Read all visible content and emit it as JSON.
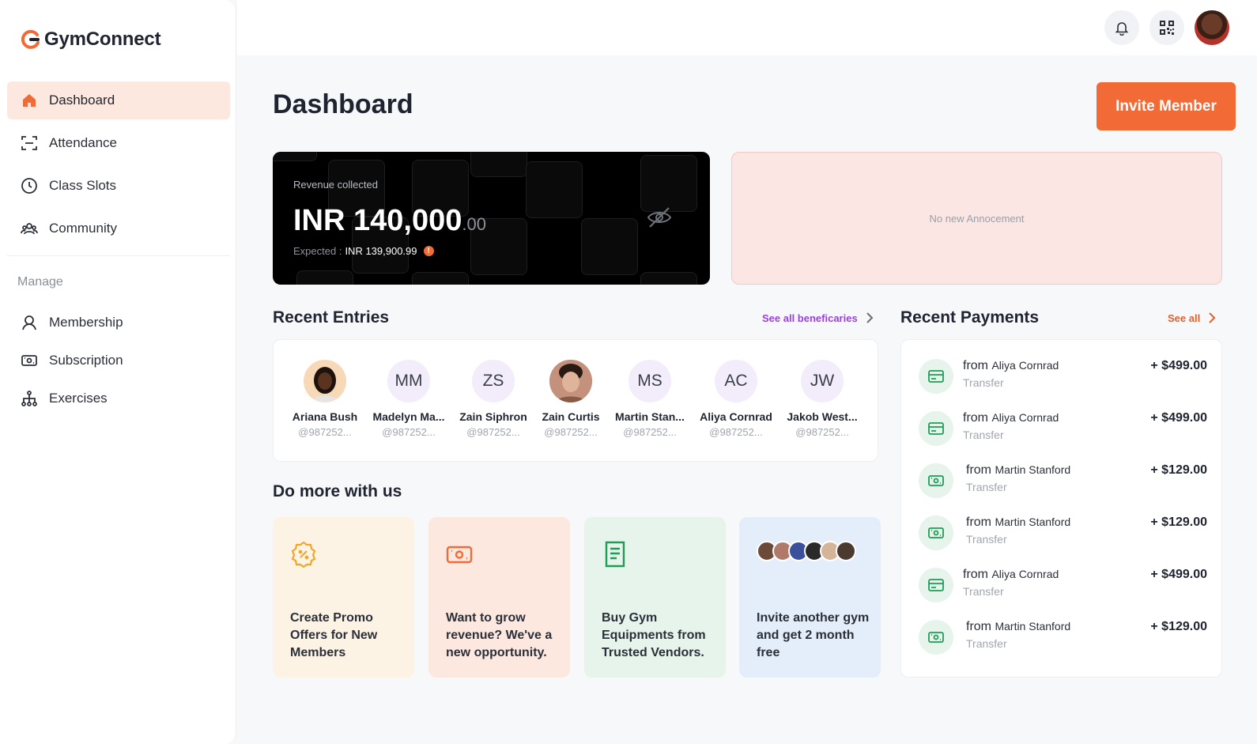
{
  "app": {
    "name": "GymConnect"
  },
  "sidebar": {
    "items": [
      {
        "label": "Dashboard",
        "icon": "home-icon",
        "active": true
      },
      {
        "label": "Attendance",
        "icon": "scan-icon"
      },
      {
        "label": "Class Slots",
        "icon": "clock-icon"
      },
      {
        "label": "Community",
        "icon": "community-icon"
      }
    ],
    "manage_label": "Manage",
    "manage_items": [
      {
        "label": "Membership",
        "icon": "membership-icon"
      },
      {
        "label": "Subscription",
        "icon": "subscription-icon"
      },
      {
        "label": "Exercises",
        "icon": "exercises-icon"
      }
    ]
  },
  "header": {
    "title": "Dashboard",
    "invite_label": "Invite Member"
  },
  "revenue": {
    "label": "Revenue collected",
    "amount": "INR 140,000",
    "cents": ".00",
    "expected_label": "Expected :",
    "expected_value": "INR 139,900.99"
  },
  "announcement": {
    "text": "No new Annocement"
  },
  "recent_entries": {
    "title": "Recent Entries",
    "link": "See all beneficaries",
    "items": [
      {
        "initials": "",
        "name": "Ariana Bush",
        "handle": "@987252..."
      },
      {
        "initials": "MM",
        "name": "Madelyn Ma...",
        "handle": "@987252..."
      },
      {
        "initials": "ZS",
        "name": "Zain Siphron",
        "handle": "@987252..."
      },
      {
        "initials": "",
        "name": "Zain Curtis",
        "handle": "@987252..."
      },
      {
        "initials": "MS",
        "name": "Martin Stan...",
        "handle": "@987252..."
      },
      {
        "initials": "AC",
        "name": "Aliya Cornrad",
        "handle": "@987252..."
      },
      {
        "initials": "JW",
        "name": "Jakob West...",
        "handle": "@987252..."
      }
    ]
  },
  "do_more": {
    "title": "Do more with us",
    "cards": [
      {
        "text": "Create Promo Offers for New Members",
        "bg": "#fdf3e4"
      },
      {
        "text": "Want to grow revenue? We've a new opportunity.",
        "bg": "#fde8e0"
      },
      {
        "text": "Buy Gym Equipments from Trusted Vendors.",
        "bg": "#e6f4ec"
      },
      {
        "text": "Invite another gym and get 2 month free",
        "bg": "#e4eefb"
      }
    ]
  },
  "recent_payments": {
    "title": "Recent Payments",
    "link": "See all",
    "items": [
      {
        "from": "from",
        "name": "Aliya Cornrad",
        "type": "Transfer",
        "amount": "+ $499.00",
        "icon": "card-icon"
      },
      {
        "from": "from",
        "name": "Aliya Cornrad",
        "type": "Transfer",
        "amount": "+ $499.00",
        "icon": "card-icon"
      },
      {
        "from": "from",
        "name": "Martin Stanford",
        "type": "Transfer",
        "amount": "+ $129.00",
        "icon": "cash-icon"
      },
      {
        "from": "from",
        "name": "Martin Stanford",
        "type": "Transfer",
        "amount": "+ $129.00",
        "icon": "cash-icon"
      },
      {
        "from": "from",
        "name": "Aliya Cornrad",
        "type": "Transfer",
        "amount": "+ $499.00",
        "icon": "card-icon"
      },
      {
        "from": "from",
        "name": "Martin Stanford",
        "type": "Transfer",
        "amount": "+ $129.00",
        "icon": "cash-icon"
      }
    ]
  },
  "colors": {
    "accent": "#f26a35",
    "link_purple": "#9b3fe0",
    "link_orange": "#e0602e",
    "green": "#1f9d57"
  }
}
